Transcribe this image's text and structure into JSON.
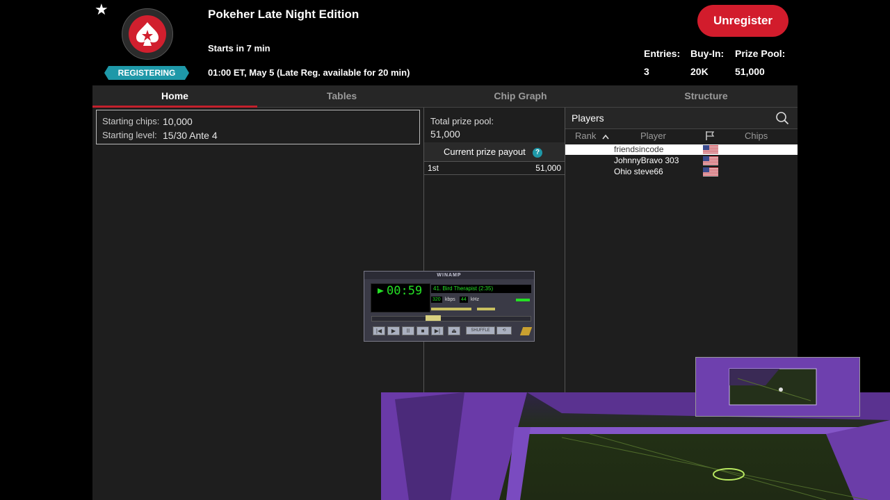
{
  "tournament": {
    "title": "Pokeher Late Night Edition",
    "starts": "Starts in 7 min",
    "time": "01:00 ET, May 5 (Late Reg. available for 20 min)",
    "status": "REGISTERING",
    "unregister_label": "Unregister",
    "stats": {
      "entries_label": "Entries:",
      "entries": "3",
      "buyin_label": "Buy-In:",
      "buyin": "20K",
      "prize_label": "Prize Pool:",
      "prize": "51,000"
    }
  },
  "tabs": [
    "Home",
    "Tables",
    "Chip Graph",
    "Structure"
  ],
  "active_tab": "Home",
  "home": {
    "starting_chips_label": "Starting chips:",
    "starting_chips": "10,000",
    "starting_level_label": "Starting level:",
    "starting_level": "15/30 Ante 4",
    "total_prize_label": "Total prize pool:",
    "total_prize": "51,000",
    "current_payout_label": "Current prize payout",
    "payouts": [
      {
        "place": "1st",
        "amount": "51,000"
      }
    ]
  },
  "players_panel": {
    "title": "Players",
    "columns": {
      "rank": "Rank",
      "player": "Player",
      "chips": "Chips"
    },
    "players": [
      {
        "name": "friendsincode",
        "country": "US",
        "highlighted": true
      },
      {
        "name": "JohnnyBravo 303",
        "country": "US",
        "highlighted": false
      },
      {
        "name": "Ohio steve66",
        "country": "US",
        "highlighted": false
      }
    ]
  },
  "winamp": {
    "title": "WINAMP",
    "time": "00:59",
    "track": "41. Bird Therapist (2:35)",
    "kbps": "320",
    "kbps_label": "kbps",
    "khz": "44",
    "khz_label": "kHz",
    "shuffle_label": "SHUFFLE"
  },
  "colors": {
    "accent_red": "#d21c2c",
    "badge_teal": "#1e98a8",
    "winamp_green": "#25e025"
  }
}
